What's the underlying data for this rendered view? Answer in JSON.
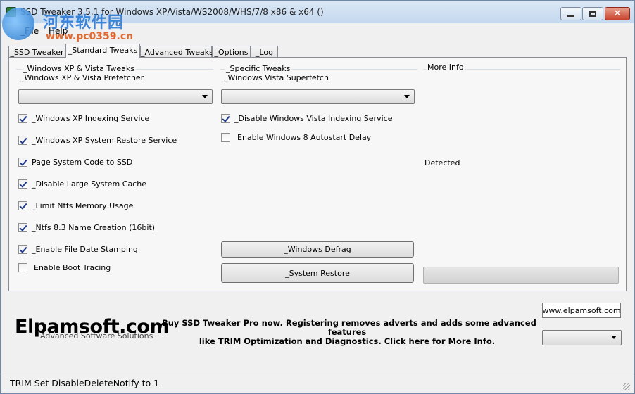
{
  "window": {
    "title": "SSD Tweaker 3.5.1 for Windows XP/Vista/WS2008/WHS/7/8 x86 & x64 ()",
    "watermark_cn": "河东软件园",
    "watermark_url": "www.pc0359.cn"
  },
  "menu": [
    {
      "label": "_File"
    },
    {
      "label": "Help"
    }
  ],
  "tabs": [
    {
      "label": "_SSD Tweaker",
      "active": false
    },
    {
      "label": "_Standard Tweaks",
      "active": true
    },
    {
      "label": "_Advanced Tweaks",
      "active": false
    },
    {
      "label": "_Options",
      "active": false
    },
    {
      "label": "_Log",
      "active": false
    }
  ],
  "xp_group": {
    "title": "_Windows XP & Vista Tweaks",
    "prefetcher_label": "_Windows XP & Vista Prefetcher",
    "prefetcher_value": "",
    "checks": [
      {
        "label": "_Windows XP Indexing Service",
        "checked": true
      },
      {
        "label": "_Windows XP System Restore Service",
        "checked": true
      },
      {
        "label": "Page System Code to SSD",
        "checked": true
      },
      {
        "label": "_Disable Large System Cache",
        "checked": true
      },
      {
        "label": "_Limit Ntfs Memory Usage",
        "checked": true
      },
      {
        "label": "_Ntfs 8.3 Name Creation (16bit)",
        "checked": true
      },
      {
        "label": "_Enable File Date Stamping",
        "checked": true
      },
      {
        "label": "Enable Boot Tracing",
        "checked": false
      }
    ]
  },
  "specific_group": {
    "title": "_Specific Tweaks",
    "superfetch_label": "_Windows Vista Superfetch",
    "superfetch_value": "",
    "checks": [
      {
        "label": "_Disable Windows Vista Indexing Service",
        "checked": true
      },
      {
        "label": "Enable Windows 8 Autostart Delay",
        "checked": false
      }
    ],
    "defrag_button": "_Windows Defrag",
    "restore_button": "_System Restore"
  },
  "more_info": {
    "title": "More Info",
    "status": "Detected"
  },
  "footer": {
    "logo_main": "Elpamsoft.com",
    "logo_sub": "Advanced Software Solutions",
    "promo_line1": "_Buy SSD Tweaker Pro now. Registering removes adverts and adds some advanced features",
    "promo_line2": "like TRIM Optimization and Diagnostics. Click here for More Info.",
    "website_button": "www.elpamsoft.com",
    "dropdown_value": ""
  },
  "status_bar": {
    "text": "TRIM Set DisableDeleteNotify to 1"
  }
}
